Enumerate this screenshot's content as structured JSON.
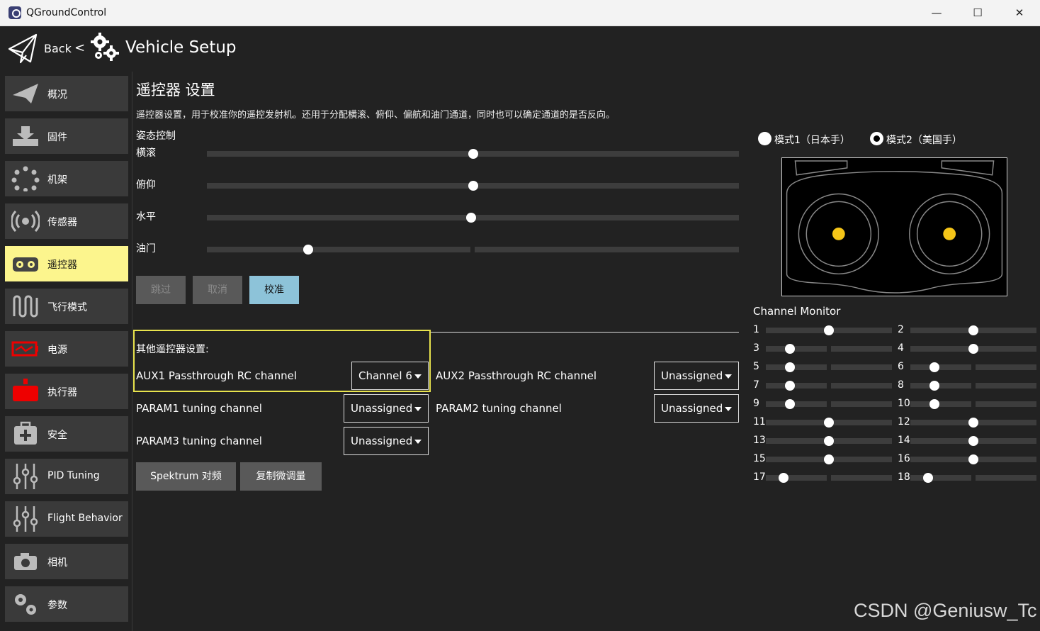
{
  "window": {
    "title": "QGroundControl",
    "minimize": "—",
    "maximize": "☐",
    "close": "✕"
  },
  "header": {
    "back_label": "Back",
    "chevron": "<",
    "title": "Vehicle Setup"
  },
  "sidebar": {
    "items": [
      {
        "label": "概况",
        "icon": "plane-icon",
        "active": false
      },
      {
        "label": "固件",
        "icon": "firmware-download-icon",
        "active": false
      },
      {
        "label": "机架",
        "icon": "airframe-icon",
        "active": false
      },
      {
        "label": "传感器",
        "icon": "sensors-icon",
        "active": false
      },
      {
        "label": "遥控器",
        "icon": "radio-controller-icon",
        "active": true
      },
      {
        "label": "飞行模式",
        "icon": "flight-modes-icon",
        "active": false
      },
      {
        "label": "电源",
        "icon": "battery-icon",
        "active": false
      },
      {
        "label": "执行器",
        "icon": "actuators-icon",
        "active": false
      },
      {
        "label": "安全",
        "icon": "safety-icon",
        "active": false
      },
      {
        "label": "PID Tuning",
        "icon": "tuning-sliders-icon",
        "active": false
      },
      {
        "label": "Flight Behavior",
        "icon": "tuning-sliders-icon",
        "active": false
      },
      {
        "label": "相机",
        "icon": "camera-icon",
        "active": false
      },
      {
        "label": "参数",
        "icon": "parameters-gears-icon",
        "active": false
      }
    ],
    "colors": {
      "active": "#fcf58d",
      "item": "#3a3a3a"
    }
  },
  "main": {
    "title": "遥控器 设置",
    "description": "遥控器设置，用于校准你的遥控发射机。还用于分配横滚、俯仰、偏航和油门通道，同时也可以确定通道的是否反向。",
    "attitude_section": "姿态控制",
    "attitude": [
      {
        "label": "横滚",
        "level": 0.5
      },
      {
        "label": "俯仰",
        "level": 0.5
      },
      {
        "label": "水平",
        "level": 0.497
      },
      {
        "label": "油门",
        "level": 0.19
      }
    ],
    "buttons": {
      "skip": "跳过",
      "cancel": "取消",
      "calibrate": "校准"
    },
    "other_section": "其他遥控器设置:",
    "options": {
      "aux1_label": "AUX1 Passthrough RC channel",
      "aux1_value": "Channel 6",
      "aux2_label": "AUX2 Passthrough RC channel",
      "aux2_value": "Unassigned",
      "param1_label": "PARAM1 tuning channel",
      "param1_value": "Unassigned",
      "param2_label": "PARAM2 tuning channel",
      "param2_value": "Unassigned",
      "param3_label": "PARAM3 tuning channel",
      "param3_value": "Unassigned"
    },
    "actions": {
      "spektrum": "Spektrum 对频",
      "copy_trims": "复制微调量"
    }
  },
  "right_panel": {
    "mode1_label": "模式1（日本手）",
    "mode2_label": "模式2（美国手）",
    "selected_mode": 2,
    "channel_monitor_title": "Channel Monitor",
    "channels": [
      {
        "n": "1",
        "level": 0.5
      },
      {
        "n": "2",
        "level": 0.5
      },
      {
        "n": "3",
        "level": 0.19
      },
      {
        "n": "4",
        "level": 0.5
      },
      {
        "n": "5",
        "level": 0.19
      },
      {
        "n": "6",
        "level": 0.19
      },
      {
        "n": "7",
        "level": 0.19
      },
      {
        "n": "8",
        "level": 0.19
      },
      {
        "n": "9",
        "level": 0.19
      },
      {
        "n": "10",
        "level": 0.19
      },
      {
        "n": "11",
        "level": 0.5
      },
      {
        "n": "12",
        "level": 0.5
      },
      {
        "n": "13",
        "level": 0.5
      },
      {
        "n": "14",
        "level": 0.5
      },
      {
        "n": "15",
        "level": 0.5
      },
      {
        "n": "16",
        "level": 0.5
      },
      {
        "n": "17",
        "level": 0.14
      },
      {
        "n": "18",
        "level": 0.14
      }
    ],
    "stick_color": "#f5c518"
  },
  "watermark": "CSDN @Geniusw_Tc"
}
